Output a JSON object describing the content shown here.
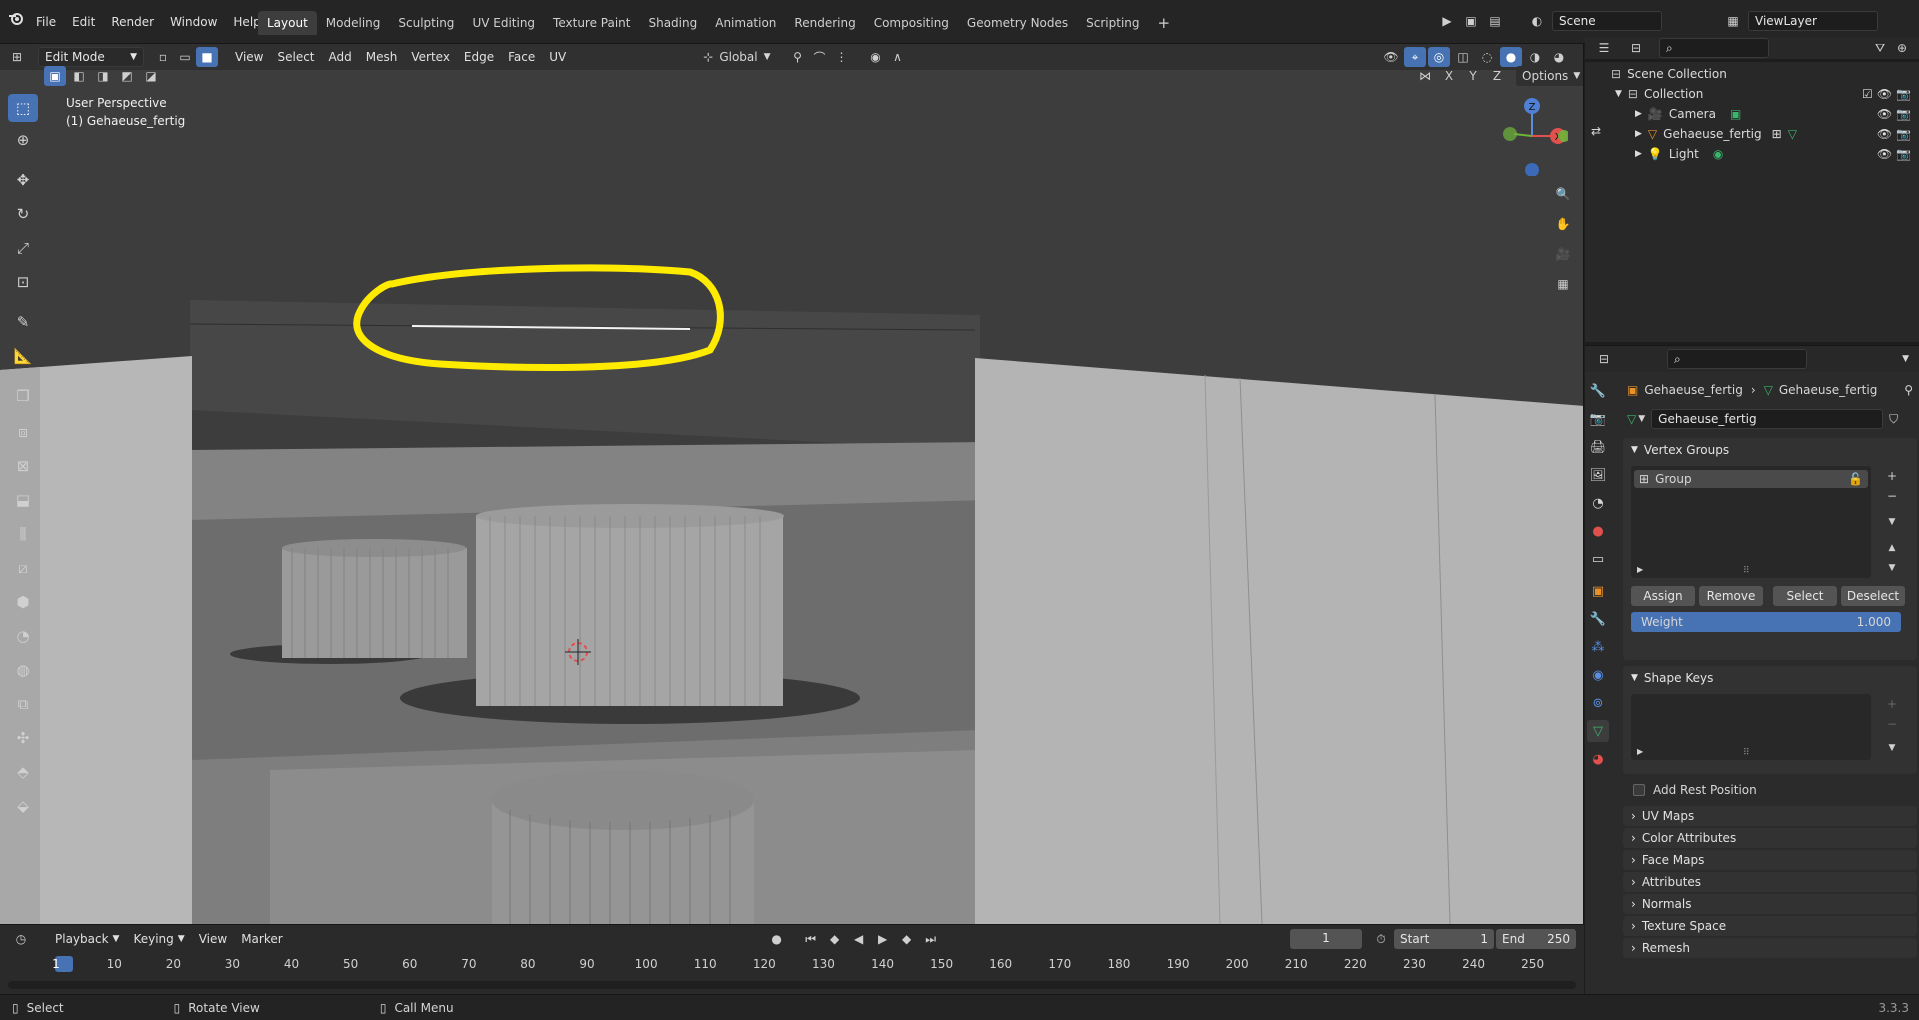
{
  "menubar": {
    "items": [
      "File",
      "Edit",
      "Render",
      "Window",
      "Help"
    ]
  },
  "workspaces": {
    "tabs": [
      "Layout",
      "Modeling",
      "Sculpting",
      "UV Editing",
      "Texture Paint",
      "Shading",
      "Animation",
      "Rendering",
      "Compositing",
      "Geometry Nodes",
      "Scripting"
    ],
    "active": "Layout"
  },
  "scene": {
    "name": "Scene",
    "view_layer": "ViewLayer"
  },
  "viewport_header": {
    "mode": "Edit Mode",
    "menus": [
      "View",
      "Select",
      "Add",
      "Mesh",
      "Vertex",
      "Edge",
      "Face",
      "UV"
    ],
    "orientation": "Global",
    "options_label": "Options",
    "axes": [
      "X",
      "Y",
      "Z"
    ]
  },
  "viewport": {
    "perspective_label": "User Perspective",
    "object_label": "(1) Gehaeuse_fertig",
    "annotation_color": "#ffeb00"
  },
  "outliner": {
    "root": "Scene Collection",
    "collection": "Collection",
    "objects": [
      {
        "name": "Camera",
        "icon": "camera-icon"
      },
      {
        "name": "Gehaeuse_fertig",
        "icon": "mesh-icon"
      },
      {
        "name": "Light",
        "icon": "light-icon"
      }
    ]
  },
  "properties": {
    "breadcrumb": [
      "Gehaeuse_fertig",
      "Gehaeuse_fertig"
    ],
    "data_name": "Gehaeuse_fertig",
    "vertex_groups": {
      "title": "Vertex Groups",
      "items": [
        "Group"
      ],
      "buttons": [
        "Assign",
        "Remove",
        "Select",
        "Deselect"
      ],
      "weight_label": "Weight",
      "weight_value": "1.000"
    },
    "shape_keys": {
      "title": "Shape Keys"
    },
    "add_rest_position": "Add Rest Position",
    "collapsed_panels": [
      "UV Maps",
      "Color Attributes",
      "Face Maps",
      "Attributes",
      "Normals",
      "Texture Space",
      "Remesh"
    ]
  },
  "timeline": {
    "menus": [
      "Playback",
      "Keying",
      "View",
      "Marker"
    ],
    "current_frame": "1",
    "start_label": "Start",
    "start": "1",
    "end_label": "End",
    "end": "250",
    "ticks": [
      "1",
      "10",
      "20",
      "30",
      "40",
      "50",
      "60",
      "70",
      "80",
      "90",
      "100",
      "110",
      "120",
      "130",
      "140",
      "150",
      "160",
      "170",
      "180",
      "190",
      "200",
      "210",
      "220",
      "230",
      "240",
      "250"
    ]
  },
  "statusbar": {
    "select": "Select",
    "rotate": "Rotate View",
    "menu": "Call Menu",
    "version": "3.3.3"
  },
  "colors": {
    "accent": "#4772b3",
    "object_orange": "#e8912a",
    "data_green": "#3ab56b"
  }
}
